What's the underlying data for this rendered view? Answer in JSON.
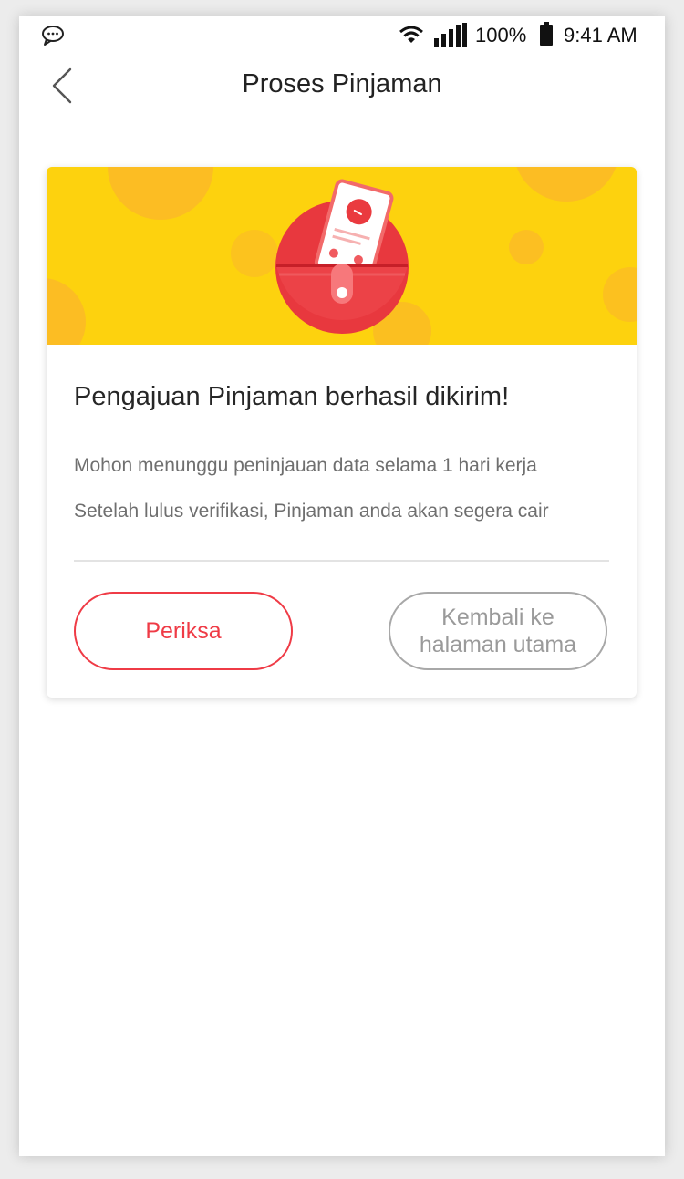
{
  "status_bar": {
    "battery": "100%",
    "time": "9:41 AM",
    "icons": [
      "chat-bubble-icon",
      "wifi-icon",
      "signal-icon",
      "battery-icon"
    ]
  },
  "header": {
    "title": "Proses Pinjaman",
    "back_icon": "chevron-left-icon"
  },
  "card": {
    "heading": "Pengajuan Pinjaman berhasil dikirim!",
    "lines": [
      "Mohon menunggu peninjauan data selama 1 hari kerja",
      "Setelah lulus verifikasi, Pinjaman anda akan segera cair"
    ],
    "buttons": {
      "check_label": "Periksa",
      "home_label": "Kembali ke halaman utama"
    }
  },
  "colors": {
    "accent_red": "#ef3b46",
    "banner_yellow": "#fdd20e",
    "button_gray": "#a8a8a8"
  }
}
